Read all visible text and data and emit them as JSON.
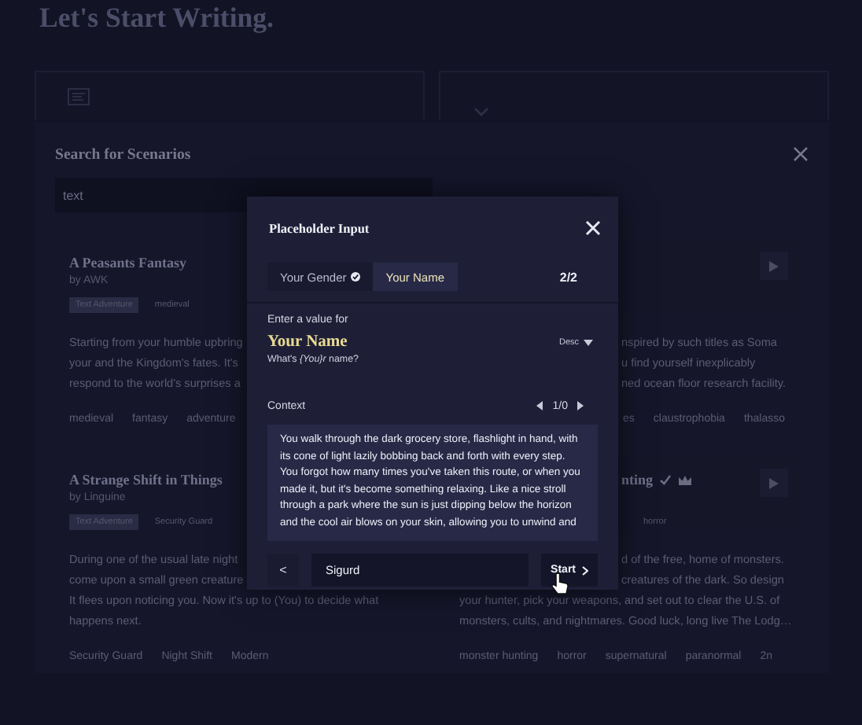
{
  "page": {
    "title": "Let's Start Writing."
  },
  "search_panel": {
    "title": "Search for Scenarios",
    "query": "text",
    "cards": [
      {
        "title": "A Peasants Fantasy",
        "author": "by AWK",
        "labels": [
          {
            "text": "Text Adventure",
            "highlighted": true
          },
          {
            "text": "medieval",
            "highlighted": false
          }
        ],
        "description": [
          "Starting from your humble upbring",
          "your and the Kingdom's fates. It's",
          "respond to the world's surprises a"
        ],
        "tags": [
          "medieval",
          "fantasy",
          "adventure"
        ],
        "playable": false
      },
      {
        "description": [
          "nspired by such titles as Soma",
          "u find yourself inexplicably",
          "ned ocean floor research facility."
        ],
        "tags": [
          "es",
          "claustrophobia",
          "thalasso"
        ],
        "playable": true
      },
      {
        "title": "A Strange Shift in Things",
        "author": "by Linguine",
        "labels": [
          {
            "text": "Text Adventure",
            "highlighted": true
          },
          {
            "text": "Security Guard",
            "highlighted": false
          }
        ],
        "description": [
          "During one of the usual late night",
          "come upon a small green creature",
          "It flees upon noticing you. Now it's up to (You) to decide what",
          "happens next."
        ],
        "tags": [
          "Security Guard",
          "Night Shift",
          "Modern"
        ],
        "playable": false
      },
      {
        "title": "nting",
        "verified": true,
        "crowned": true,
        "labels": [
          {
            "text": "horror",
            "highlighted": false
          }
        ],
        "description": [
          "d of the free, home of monsters.",
          "creatures of the dark. So design",
          "your hunter, pick your weapons, and set out to clear the U.S. of",
          "monsters, cults, and nightmares. Good luck, long live The Lodg…"
        ],
        "tags": [
          "monster hunting",
          "horror",
          "supernatural",
          "paranormal",
          "2n"
        ],
        "playable": true
      }
    ]
  },
  "modal": {
    "title": "Placeholder Input",
    "steps": [
      {
        "label": "Your Gender",
        "done": true,
        "selected": false
      },
      {
        "label": "Your Name",
        "done": false,
        "selected": true
      }
    ],
    "counter": "2/2",
    "prompt": "Enter a value for",
    "field_name": "Your Name",
    "sort": "Desc",
    "hint": "What's *{You}r* name?",
    "context_label": "Context",
    "context_counter": "1/0",
    "context_text": "You walk through the dark grocery store, flashlight in hand, with its cone of light lazily bobbing back and forth with every step. You forgot how many times you've taken this route, or when you made it, but it's become something relaxing. Like a nice stroll through a park where the sun is just dipping below the horizon and the cool air blows on your skin, allowing you to unwind and",
    "back": "<",
    "value": "Sigurd",
    "start": "Start"
  }
}
